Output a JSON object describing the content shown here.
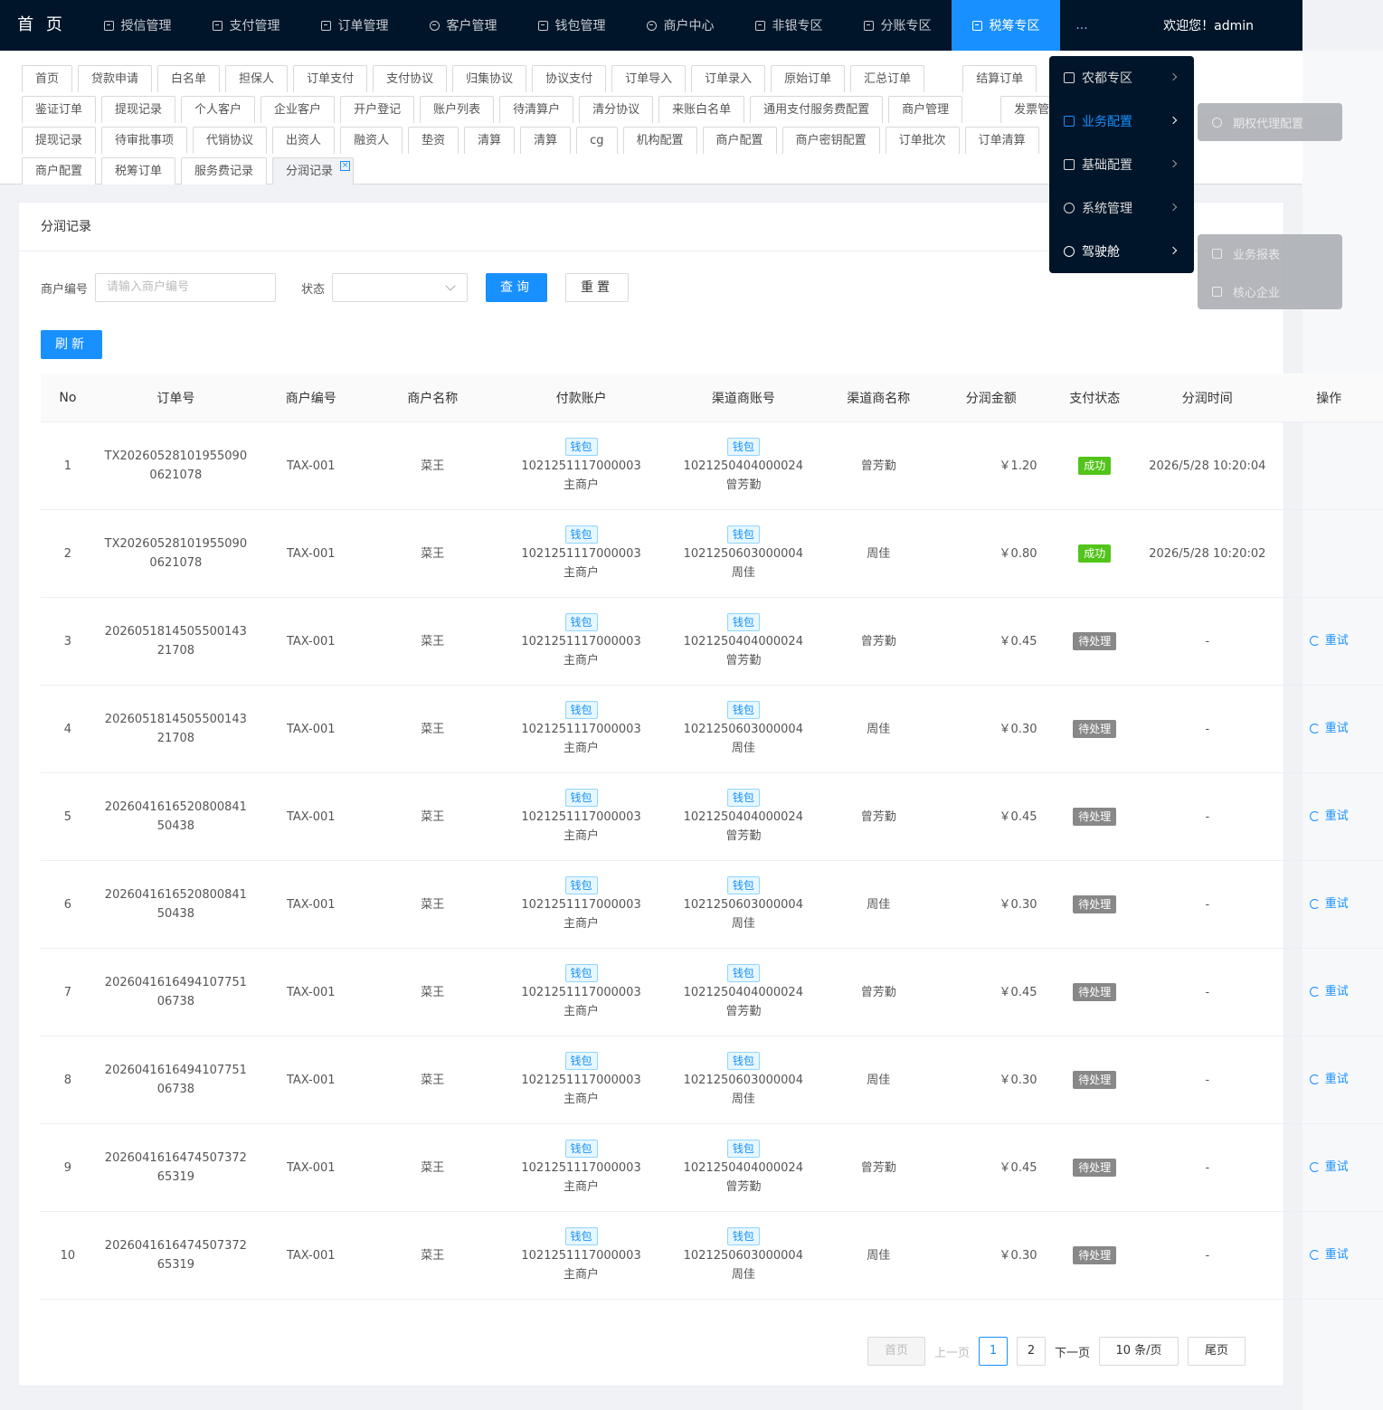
{
  "nav": {
    "home": "首 页",
    "items": [
      "授信管理",
      "支付管理",
      "订单管理",
      "客户管理",
      "钱包管理",
      "商户中心",
      "非银专区",
      "分账专区",
      "税筹专区"
    ],
    "more": "...",
    "welcome": "欢迎您！admin"
  },
  "tabs": {
    "row1": [
      "首页",
      "贷款申请",
      "白名单",
      "担保人",
      "订单支付",
      "支付协议",
      "归集协议",
      "协议支付",
      "订单导入",
      "订单录入",
      "原始订单",
      "汇总订单",
      "",
      "结算订单"
    ],
    "row2": [
      "鉴证订单",
      "提现记录",
      "个人客户",
      "企业客户",
      "开户登记",
      "账户列表",
      "待清算户",
      "清分协议",
      "来账白名单",
      "通用支付服务费配置",
      "商户管理",
      "",
      "发票管理"
    ],
    "row3": [
      "提现记录",
      "待审批事项",
      "代销协议",
      "出资人",
      "融资人",
      "垫资",
      "清算",
      "清算",
      "cg",
      "机构配置",
      "商户配置",
      "商户密钥配置",
      "订单批次",
      "订单清算"
    ],
    "row4": [
      "商户配置",
      "税筹订单",
      "服务费记录"
    ],
    "active": "分润记录",
    "close": "×"
  },
  "card": {
    "title": "分润记录",
    "search": {
      "merchant_label": "商户编号",
      "merchant_placeholder": "请输入商户编号",
      "status_label": "状态",
      "query": "查询",
      "reset": "重置"
    },
    "refresh": "刷新"
  },
  "table": {
    "headers": [
      "No",
      "订单号",
      "商户编号",
      "商户名称",
      "付款账户",
      "渠道商账号",
      "渠道商名称",
      "分润金额",
      "支付状态",
      "分润时间",
      "操作"
    ],
    "wallet_tag": "钱包",
    "retry": "重试",
    "rows": [
      {
        "no": "1",
        "order1": "TX20260528101955090",
        "order2": "0621078",
        "mno": "TAX-001",
        "mname": "菜王",
        "pay_acc": "1021251117000003",
        "pay_name": "主商户",
        "chan_acc": "1021250404000024",
        "chan_name": "曾芳勤",
        "chname": "曾芳勤",
        "amount": "￥1.20",
        "status": "成功",
        "time": "2026/5/28 10:20:04",
        "op": ""
      },
      {
        "no": "2",
        "order1": "TX20260528101955090",
        "order2": "0621078",
        "mno": "TAX-001",
        "mname": "菜王",
        "pay_acc": "1021251117000003",
        "pay_name": "主商户",
        "chan_acc": "1021250603000004",
        "chan_name": "周佳",
        "chname": "周佳",
        "amount": "￥0.80",
        "status": "成功",
        "time": "2026/5/28 10:20:02",
        "op": ""
      },
      {
        "no": "3",
        "order1": "2026051814505500143",
        "order2": "21708",
        "mno": "TAX-001",
        "mname": "菜王",
        "pay_acc": "1021251117000003",
        "pay_name": "主商户",
        "chan_acc": "1021250404000024",
        "chan_name": "曾芳勤",
        "chname": "曾芳勤",
        "amount": "￥0.45",
        "status": "待处理",
        "time": "-",
        "op": "重试"
      },
      {
        "no": "4",
        "order1": "2026051814505500143",
        "order2": "21708",
        "mno": "TAX-001",
        "mname": "菜王",
        "pay_acc": "1021251117000003",
        "pay_name": "主商户",
        "chan_acc": "1021250603000004",
        "chan_name": "周佳",
        "chname": "周佳",
        "amount": "￥0.30",
        "status": "待处理",
        "time": "-",
        "op": "重试"
      },
      {
        "no": "5",
        "order1": "2026041616520800841",
        "order2": "50438",
        "mno": "TAX-001",
        "mname": "菜王",
        "pay_acc": "1021251117000003",
        "pay_name": "主商户",
        "chan_acc": "1021250404000024",
        "chan_name": "曾芳勤",
        "chname": "曾芳勤",
        "amount": "￥0.45",
        "status": "待处理",
        "time": "-",
        "op": "重试"
      },
      {
        "no": "6",
        "order1": "2026041616520800841",
        "order2": "50438",
        "mno": "TAX-001",
        "mname": "菜王",
        "pay_acc": "1021251117000003",
        "pay_name": "主商户",
        "chan_acc": "1021250603000004",
        "chan_name": "周佳",
        "chname": "周佳",
        "amount": "￥0.30",
        "status": "待处理",
        "time": "-",
        "op": "重试"
      },
      {
        "no": "7",
        "order1": "2026041616494107751",
        "order2": "06738",
        "mno": "TAX-001",
        "mname": "菜王",
        "pay_acc": "1021251117000003",
        "pay_name": "主商户",
        "chan_acc": "1021250404000024",
        "chan_name": "曾芳勤",
        "chname": "曾芳勤",
        "amount": "￥0.45",
        "status": "待处理",
        "time": "-",
        "op": "重试"
      },
      {
        "no": "8",
        "order1": "2026041616494107751",
        "order2": "06738",
        "mno": "TAX-001",
        "mname": "菜王",
        "pay_acc": "1021251117000003",
        "pay_name": "主商户",
        "chan_acc": "1021250603000004",
        "chan_name": "周佳",
        "chname": "周佳",
        "amount": "￥0.30",
        "status": "待处理",
        "time": "-",
        "op": "重试"
      },
      {
        "no": "9",
        "order1": "2026041616474507372",
        "order2": "65319",
        "mno": "TAX-001",
        "mname": "菜王",
        "pay_acc": "1021251117000003",
        "pay_name": "主商户",
        "chan_acc": "1021250404000024",
        "chan_name": "曾芳勤",
        "chname": "曾芳勤",
        "amount": "￥0.45",
        "status": "待处理",
        "time": "-",
        "op": "重试"
      },
      {
        "no": "10",
        "order1": "2026041616474507372",
        "order2": "65319",
        "mno": "TAX-001",
        "mname": "菜王",
        "pay_acc": "1021251117000003",
        "pay_name": "主商户",
        "chan_acc": "1021250603000004",
        "chan_name": "周佳",
        "chname": "周佳",
        "amount": "￥0.30",
        "status": "待处理",
        "time": "-",
        "op": "重试"
      }
    ]
  },
  "pager": {
    "first": "首页",
    "prev": "上一页",
    "pages": [
      "1",
      "2"
    ],
    "next": "下一页",
    "size": "10 条/页",
    "last": "尾页"
  },
  "dropdown": {
    "items": [
      "农都专区",
      "业务配置",
      "基础配置",
      "系统管理",
      "驾驶舱"
    ],
    "sub1": "期权代理配置",
    "sub2": [
      "业务报表",
      "核心企业"
    ]
  },
  "colors": {
    "accent": "#1890ff",
    "nav_bg": "#001529",
    "success": "#52c41a",
    "pending": "#888888"
  }
}
